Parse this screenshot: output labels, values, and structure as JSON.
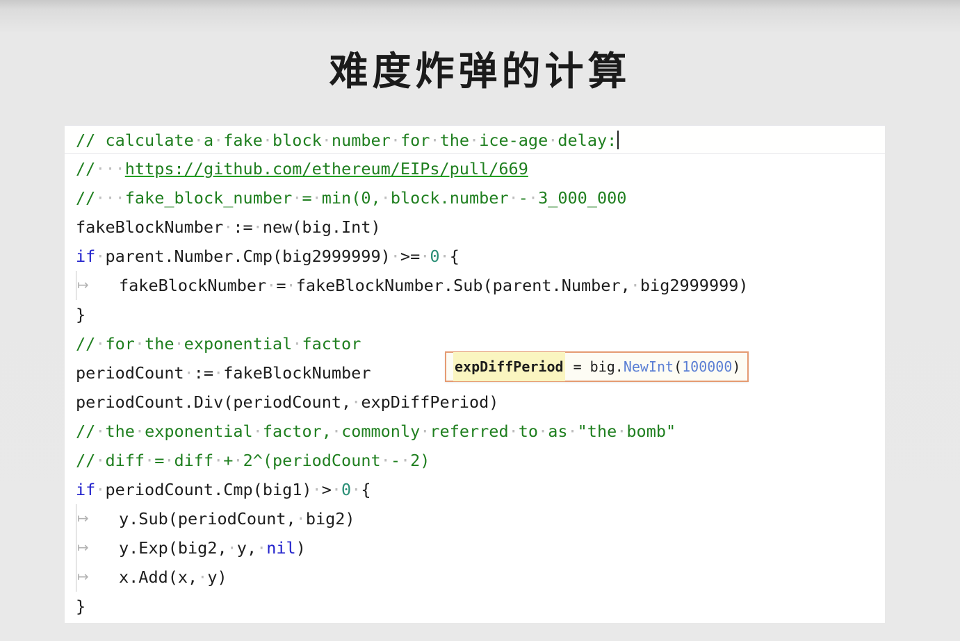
{
  "slide": {
    "title": "难度炸弹的计算",
    "background_color": "#e9e9e9"
  },
  "colors": {
    "comment_green": "#1f7f1f",
    "keyword_blue": "#2222cc",
    "literal_teal": "#2a8f76",
    "function_blue": "#4a70c8",
    "tooltip_border": "#e59b72",
    "tooltip_background": "#fdfcf4",
    "tooltip_highlight": "#faf5c0",
    "code_background": "#ffffff",
    "code_text": "#1d1d1d"
  },
  "editor": {
    "language": "go",
    "whitespace_dot": "·",
    "tab_arrow": "↦",
    "caret_line": 1,
    "lines": [
      {
        "n": 1,
        "current": true,
        "caret": true,
        "indent_guide": false,
        "tokens": [
          {
            "t": "// ",
            "c": "cmt"
          },
          {
            "t": "calculate",
            "c": "cmt"
          },
          {
            "t": "·",
            "c": "dot"
          },
          {
            "t": "a",
            "c": "cmt"
          },
          {
            "t": "·",
            "c": "dot"
          },
          {
            "t": "fake",
            "c": "cmt"
          },
          {
            "t": "·",
            "c": "dot"
          },
          {
            "t": "block",
            "c": "cmt"
          },
          {
            "t": "·",
            "c": "dot"
          },
          {
            "t": "number",
            "c": "cmt"
          },
          {
            "t": "·",
            "c": "dot"
          },
          {
            "t": "for",
            "c": "cmt"
          },
          {
            "t": "·",
            "c": "dot"
          },
          {
            "t": "the",
            "c": "cmt"
          },
          {
            "t": "·",
            "c": "dot"
          },
          {
            "t": "ice-age",
            "c": "cmt"
          },
          {
            "t": "·",
            "c": "dot"
          },
          {
            "t": "delay:",
            "c": "cmt"
          }
        ],
        "text": "// calculate a fake block number for the ice-age delay:"
      },
      {
        "n": 2,
        "current": false,
        "caret": false,
        "indent_guide": false,
        "tokens": [
          {
            "t": "//",
            "c": "cmt"
          },
          {
            "t": "·",
            "c": "dot"
          },
          {
            "t": "·",
            "c": "dot"
          },
          {
            "t": "·",
            "c": "dot"
          },
          {
            "t": "https://github.com/ethereum/EIPs/pull/669",
            "c": "cmt-url"
          }
        ],
        "text": "//   https://github.com/ethereum/EIPs/pull/669"
      },
      {
        "n": 3,
        "current": false,
        "caret": false,
        "indent_guide": false,
        "tokens": [
          {
            "t": "//",
            "c": "cmt"
          },
          {
            "t": "·",
            "c": "dot"
          },
          {
            "t": "·",
            "c": "dot"
          },
          {
            "t": "·",
            "c": "dot"
          },
          {
            "t": "fake_block_number",
            "c": "cmt"
          },
          {
            "t": "·",
            "c": "dot"
          },
          {
            "t": "=",
            "c": "cmt"
          },
          {
            "t": "·",
            "c": "dot"
          },
          {
            "t": "min(0,",
            "c": "cmt"
          },
          {
            "t": "·",
            "c": "dot"
          },
          {
            "t": "block.number",
            "c": "cmt"
          },
          {
            "t": "·",
            "c": "dot"
          },
          {
            "t": "-",
            "c": "cmt"
          },
          {
            "t": "·",
            "c": "dot"
          },
          {
            "t": "3_000_000",
            "c": "cmt"
          }
        ],
        "text": "//   fake_block_number = min(0, block.number - 3_000_000"
      },
      {
        "n": 4,
        "current": false,
        "caret": false,
        "indent_guide": false,
        "tokens": [
          {
            "t": "fakeBlockNumber",
            "c": "plain"
          },
          {
            "t": "·",
            "c": "dot"
          },
          {
            "t": ":=",
            "c": "plain"
          },
          {
            "t": "·",
            "c": "dot"
          },
          {
            "t": "new(big.Int)",
            "c": "plain"
          }
        ],
        "text": "fakeBlockNumber := new(big.Int)"
      },
      {
        "n": 5,
        "current": false,
        "caret": false,
        "indent_guide": false,
        "tokens": [
          {
            "t": "if",
            "c": "kw"
          },
          {
            "t": "·",
            "c": "dot"
          },
          {
            "t": "parent.Number.Cmp(big2999999)",
            "c": "plain"
          },
          {
            "t": "·",
            "c": "dot"
          },
          {
            "t": ">=",
            "c": "plain"
          },
          {
            "t": "·",
            "c": "dot"
          },
          {
            "t": "0",
            "c": "num0"
          },
          {
            "t": "·",
            "c": "dot"
          },
          {
            "t": "{",
            "c": "plain"
          }
        ],
        "text": "if parent.Number.Cmp(big2999999) >= 0 {"
      },
      {
        "n": 6,
        "current": false,
        "caret": false,
        "indent_guide": true,
        "indent": true,
        "tokens": [
          {
            "t": "fakeBlockNumber",
            "c": "plain"
          },
          {
            "t": "·",
            "c": "dot"
          },
          {
            "t": "=",
            "c": "plain"
          },
          {
            "t": "·",
            "c": "dot"
          },
          {
            "t": "fakeBlockNumber.Sub(parent.Number,",
            "c": "plain"
          },
          {
            "t": "·",
            "c": "dot"
          },
          {
            "t": "big2999999)",
            "c": "plain"
          }
        ],
        "text": "    fakeBlockNumber = fakeBlockNumber.Sub(parent.Number, big2999999)"
      },
      {
        "n": 7,
        "current": false,
        "caret": false,
        "indent_guide": false,
        "tokens": [
          {
            "t": "}",
            "c": "plain"
          }
        ],
        "text": "}"
      },
      {
        "n": 8,
        "current": false,
        "caret": false,
        "indent_guide": false,
        "tokens": [
          {
            "t": "//",
            "c": "cmt"
          },
          {
            "t": "·",
            "c": "dot"
          },
          {
            "t": "for",
            "c": "cmt"
          },
          {
            "t": "·",
            "c": "dot"
          },
          {
            "t": "the",
            "c": "cmt"
          },
          {
            "t": "·",
            "c": "dot"
          },
          {
            "t": "exponential",
            "c": "cmt"
          },
          {
            "t": "·",
            "c": "dot"
          },
          {
            "t": "factor",
            "c": "cmt"
          }
        ],
        "text": "// for the exponential factor"
      },
      {
        "n": 9,
        "current": false,
        "caret": false,
        "indent_guide": false,
        "tokens": [
          {
            "t": "periodCount",
            "c": "plain"
          },
          {
            "t": "·",
            "c": "dot"
          },
          {
            "t": ":=",
            "c": "plain"
          },
          {
            "t": "·",
            "c": "dot"
          },
          {
            "t": "fakeBlockNumber",
            "c": "plain"
          }
        ],
        "text": "periodCount := fakeBlockNumber"
      },
      {
        "n": 10,
        "current": false,
        "caret": false,
        "indent_guide": false,
        "tokens": [
          {
            "t": "periodCount.Div(periodCount,",
            "c": "plain"
          },
          {
            "t": "·",
            "c": "dot"
          },
          {
            "t": "expDiffPeriod)",
            "c": "plain"
          }
        ],
        "text": "periodCount.Div(periodCount, expDiffPeriod)"
      },
      {
        "n": 11,
        "current": false,
        "caret": false,
        "indent_guide": false,
        "tokens": [
          {
            "t": "//",
            "c": "cmt"
          },
          {
            "t": "·",
            "c": "dot"
          },
          {
            "t": "the",
            "c": "cmt"
          },
          {
            "t": "·",
            "c": "dot"
          },
          {
            "t": "exponential",
            "c": "cmt"
          },
          {
            "t": "·",
            "c": "dot"
          },
          {
            "t": "factor,",
            "c": "cmt"
          },
          {
            "t": "·",
            "c": "dot"
          },
          {
            "t": "commonly",
            "c": "cmt"
          },
          {
            "t": "·",
            "c": "dot"
          },
          {
            "t": "referred",
            "c": "cmt"
          },
          {
            "t": "·",
            "c": "dot"
          },
          {
            "t": "to",
            "c": "cmt"
          },
          {
            "t": "·",
            "c": "dot"
          },
          {
            "t": "as",
            "c": "cmt"
          },
          {
            "t": "·",
            "c": "dot"
          },
          {
            "t": "\"the",
            "c": "cmt"
          },
          {
            "t": "·",
            "c": "dot"
          },
          {
            "t": "bomb\"",
            "c": "cmt"
          }
        ],
        "text": "// the exponential factor, commonly referred to as \"the bomb\""
      },
      {
        "n": 12,
        "current": false,
        "caret": false,
        "indent_guide": false,
        "tokens": [
          {
            "t": "//",
            "c": "cmt"
          },
          {
            "t": "·",
            "c": "dot"
          },
          {
            "t": "diff",
            "c": "cmt"
          },
          {
            "t": "·",
            "c": "dot"
          },
          {
            "t": "=",
            "c": "cmt"
          },
          {
            "t": "·",
            "c": "dot"
          },
          {
            "t": "diff",
            "c": "cmt"
          },
          {
            "t": "·",
            "c": "dot"
          },
          {
            "t": "+",
            "c": "cmt"
          },
          {
            "t": "·",
            "c": "dot"
          },
          {
            "t": "2^(periodCount",
            "c": "cmt"
          },
          {
            "t": "·",
            "c": "dot"
          },
          {
            "t": "-",
            "c": "cmt"
          },
          {
            "t": "·",
            "c": "dot"
          },
          {
            "t": "2)",
            "c": "cmt"
          }
        ],
        "text": "// diff = diff + 2^(periodCount - 2)"
      },
      {
        "n": 13,
        "current": false,
        "caret": false,
        "indent_guide": false,
        "tokens": [
          {
            "t": "if",
            "c": "kw"
          },
          {
            "t": "·",
            "c": "dot"
          },
          {
            "t": "periodCount.Cmp(big1)",
            "c": "plain"
          },
          {
            "t": "·",
            "c": "dot"
          },
          {
            "t": ">",
            "c": "plain"
          },
          {
            "t": "·",
            "c": "dot"
          },
          {
            "t": "0",
            "c": "num0"
          },
          {
            "t": "·",
            "c": "dot"
          },
          {
            "t": "{",
            "c": "plain"
          }
        ],
        "text": "if periodCount.Cmp(big1) > 0 {"
      },
      {
        "n": 14,
        "current": false,
        "caret": false,
        "indent_guide": true,
        "indent": true,
        "tokens": [
          {
            "t": "y.Sub(periodCount,",
            "c": "plain"
          },
          {
            "t": "·",
            "c": "dot"
          },
          {
            "t": "big2)",
            "c": "plain"
          }
        ],
        "text": "    y.Sub(periodCount, big2)"
      },
      {
        "n": 15,
        "current": false,
        "caret": false,
        "indent_guide": true,
        "indent": true,
        "tokens": [
          {
            "t": "y.Exp(big2,",
            "c": "plain"
          },
          {
            "t": "·",
            "c": "dot"
          },
          {
            "t": "y,",
            "c": "plain"
          },
          {
            "t": "·",
            "c": "dot"
          },
          {
            "t": "nil",
            "c": "kw"
          },
          {
            "t": ")",
            "c": "plain"
          }
        ],
        "text": "    y.Exp(big2, y, nil)"
      },
      {
        "n": 16,
        "current": false,
        "caret": false,
        "indent_guide": true,
        "indent": true,
        "tokens": [
          {
            "t": "x.Add(x,",
            "c": "plain"
          },
          {
            "t": "·",
            "c": "dot"
          },
          {
            "t": "y)",
            "c": "plain"
          }
        ],
        "text": "    x.Add(x, y)"
      },
      {
        "n": 17,
        "current": false,
        "caret": false,
        "indent_guide": false,
        "tokens": [
          {
            "t": "}",
            "c": "plain"
          }
        ],
        "text": "}"
      }
    ]
  },
  "tooltip": {
    "symbol": "expDiffPeriod",
    "equals": " = ",
    "package": "big.",
    "method": "NewInt",
    "open_paren": "(",
    "value": "100000",
    "close_paren": ")",
    "full_text": "expDiffPeriod = big.NewInt(100000)"
  }
}
